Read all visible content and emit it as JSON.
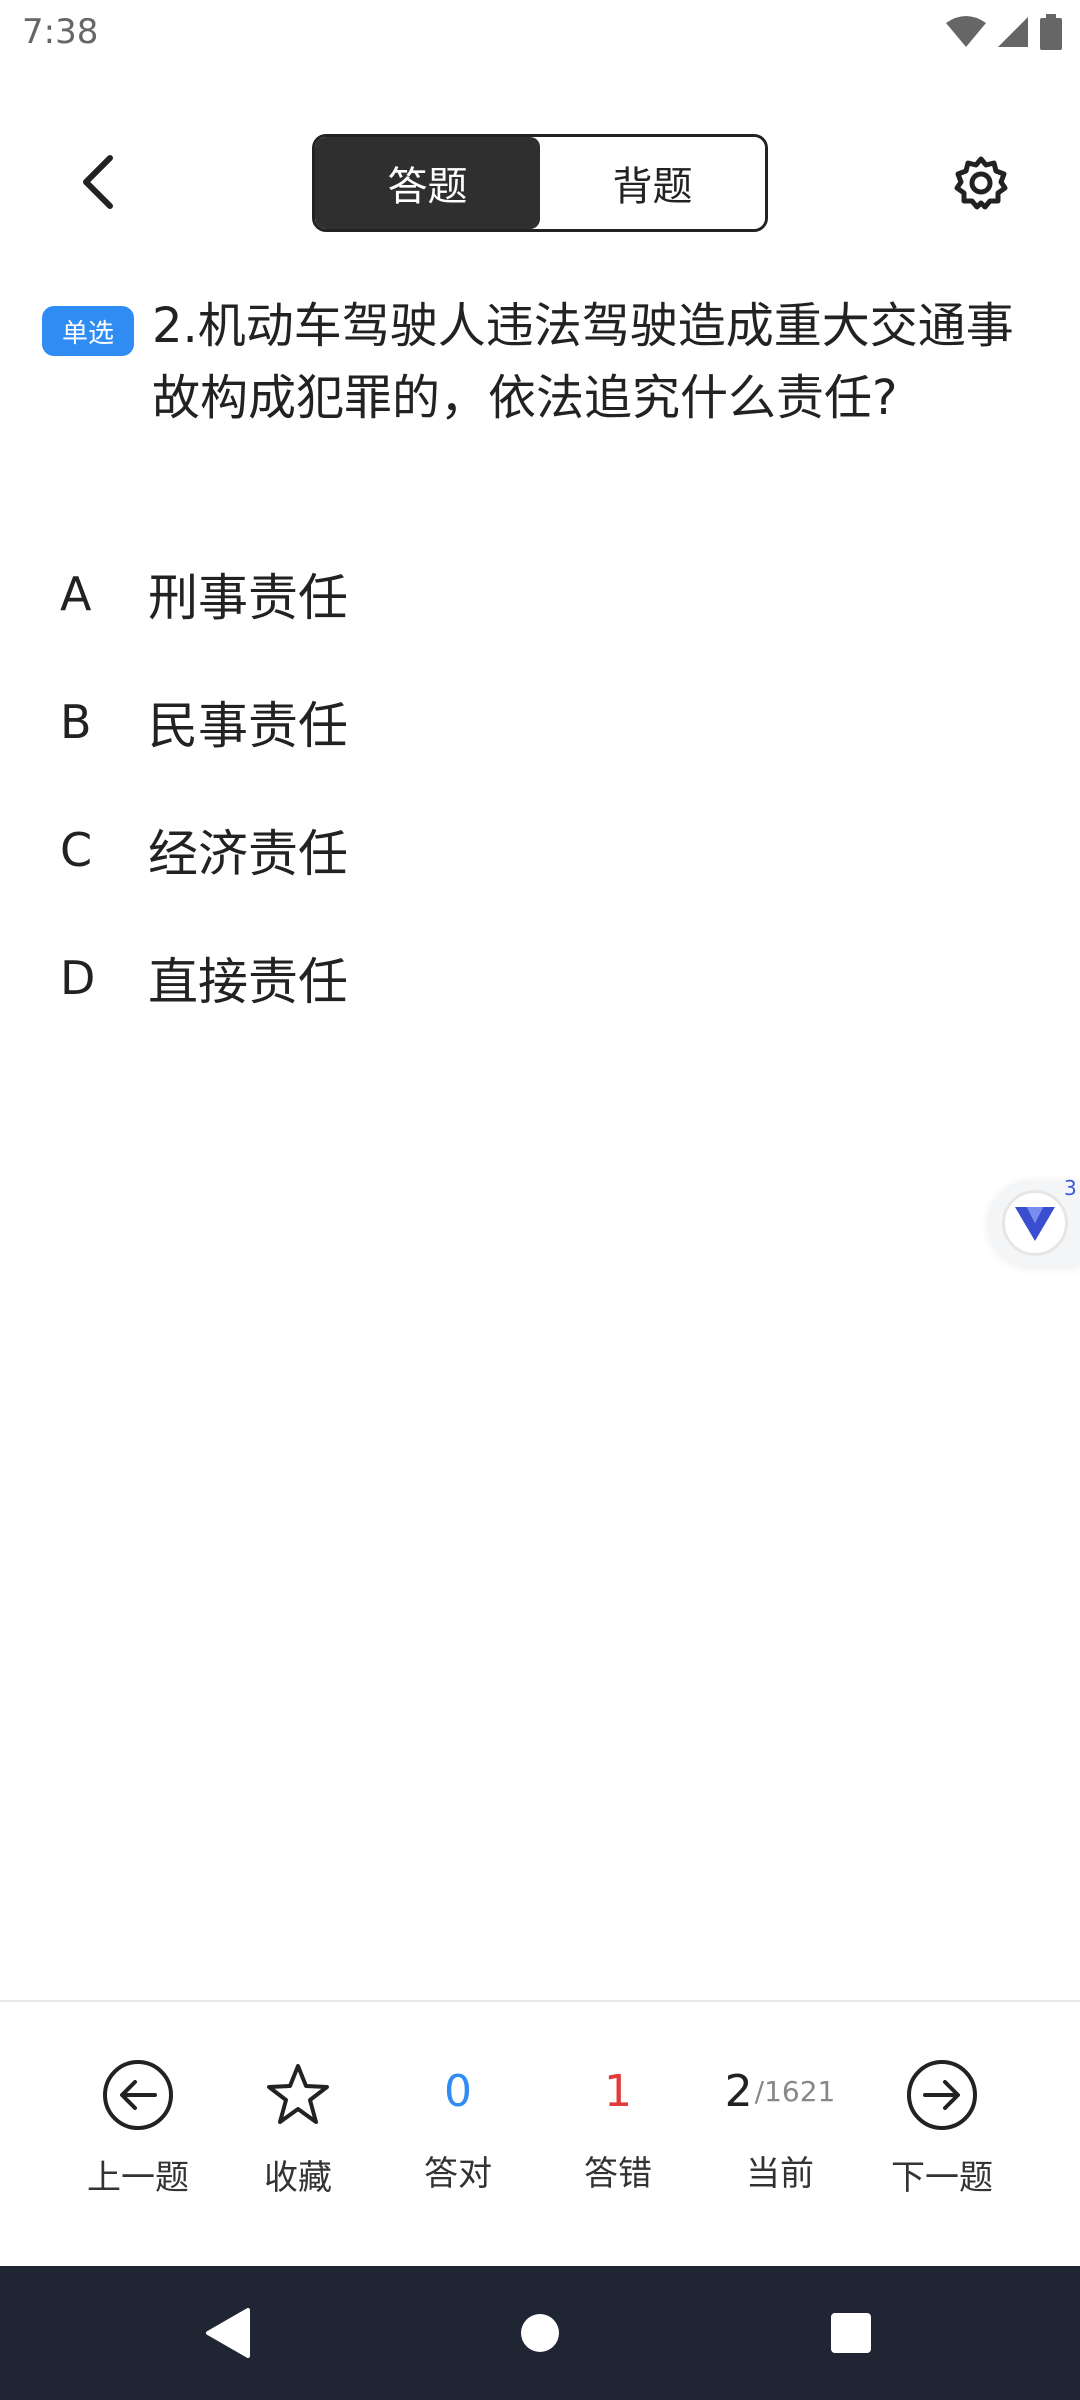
{
  "status_bar": {
    "time": "7:38"
  },
  "header": {
    "tabs": [
      {
        "label": "答题",
        "active": true
      },
      {
        "label": "背题",
        "active": false
      }
    ]
  },
  "question": {
    "type_badge": "单选",
    "text": "2.机动车驾驶人违法驾驶造成重大交通事故构成犯罪的，依法追究什么责任?"
  },
  "options": [
    {
      "letter": "A",
      "text": "刑事责任"
    },
    {
      "letter": "B",
      "text": "民事责任"
    },
    {
      "letter": "C",
      "text": "经济责任"
    },
    {
      "letter": "D",
      "text": "直接责任"
    }
  ],
  "floating_widget": {
    "count": "3"
  },
  "toolbar": {
    "prev_label": "上一题",
    "favorite_label": "收藏",
    "correct_count": "0",
    "correct_label": "答对",
    "wrong_count": "1",
    "wrong_label": "答错",
    "current_num": "2",
    "current_total": "/1621",
    "current_label": "当前",
    "next_label": "下一题"
  },
  "colors": {
    "accent_blue": "#2f8cf3",
    "error_red": "#e23b3b",
    "segment_active": "#2f2f2f",
    "nav_bar": "#1f2533"
  }
}
